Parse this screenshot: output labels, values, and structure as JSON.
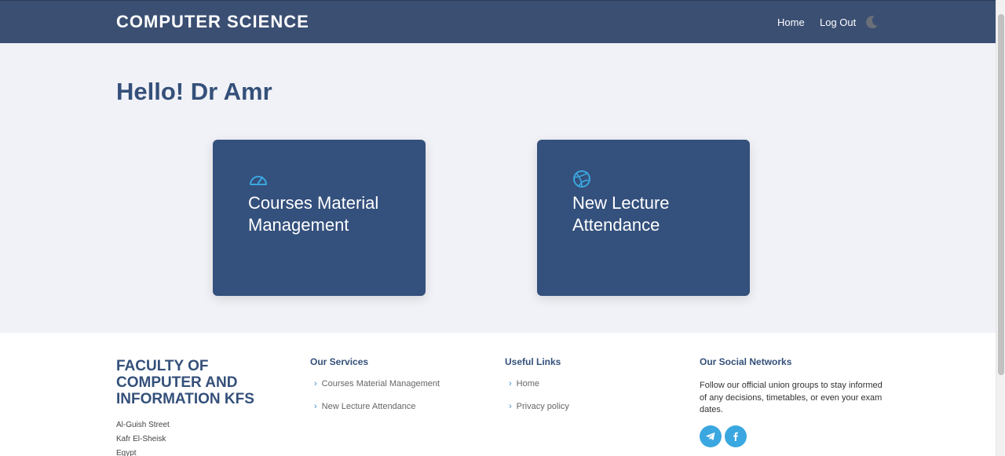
{
  "nav": {
    "brand": "COMPUTER SCIENCE",
    "links": [
      {
        "label": "Home"
      },
      {
        "label": "Log Out"
      }
    ],
    "theme_icon": "moon-icon"
  },
  "main": {
    "greeting": "Hello! Dr Amr",
    "cards": [
      {
        "title": "Courses Material Management",
        "icon": "speedometer-icon"
      },
      {
        "title": "New Lecture Attendance",
        "icon": "basketball-icon"
      }
    ]
  },
  "footer": {
    "faculty": "FACULTY OF COMPUTER AND INFORMATION KFS",
    "address": [
      "Al-Guish Street",
      "Kafr El-Sheisk",
      "Egypt"
    ],
    "services": {
      "heading": "Our Services",
      "items": [
        "Courses Material Management",
        "New Lecture Attendance"
      ]
    },
    "useful_links": {
      "heading": "Useful Links",
      "items": [
        "Home",
        "Privacy policy"
      ]
    },
    "social": {
      "heading": "Our Social Networks",
      "text": "Follow our official union groups to stay informed of any decisions, timetables, or even your exam dates.",
      "icons": [
        "telegram-icon",
        "facebook-icon"
      ]
    }
  },
  "colors": {
    "navbar": "#3b4f73",
    "card": "#34507c",
    "accent": "#3ba7e0",
    "heading": "#34507a"
  }
}
